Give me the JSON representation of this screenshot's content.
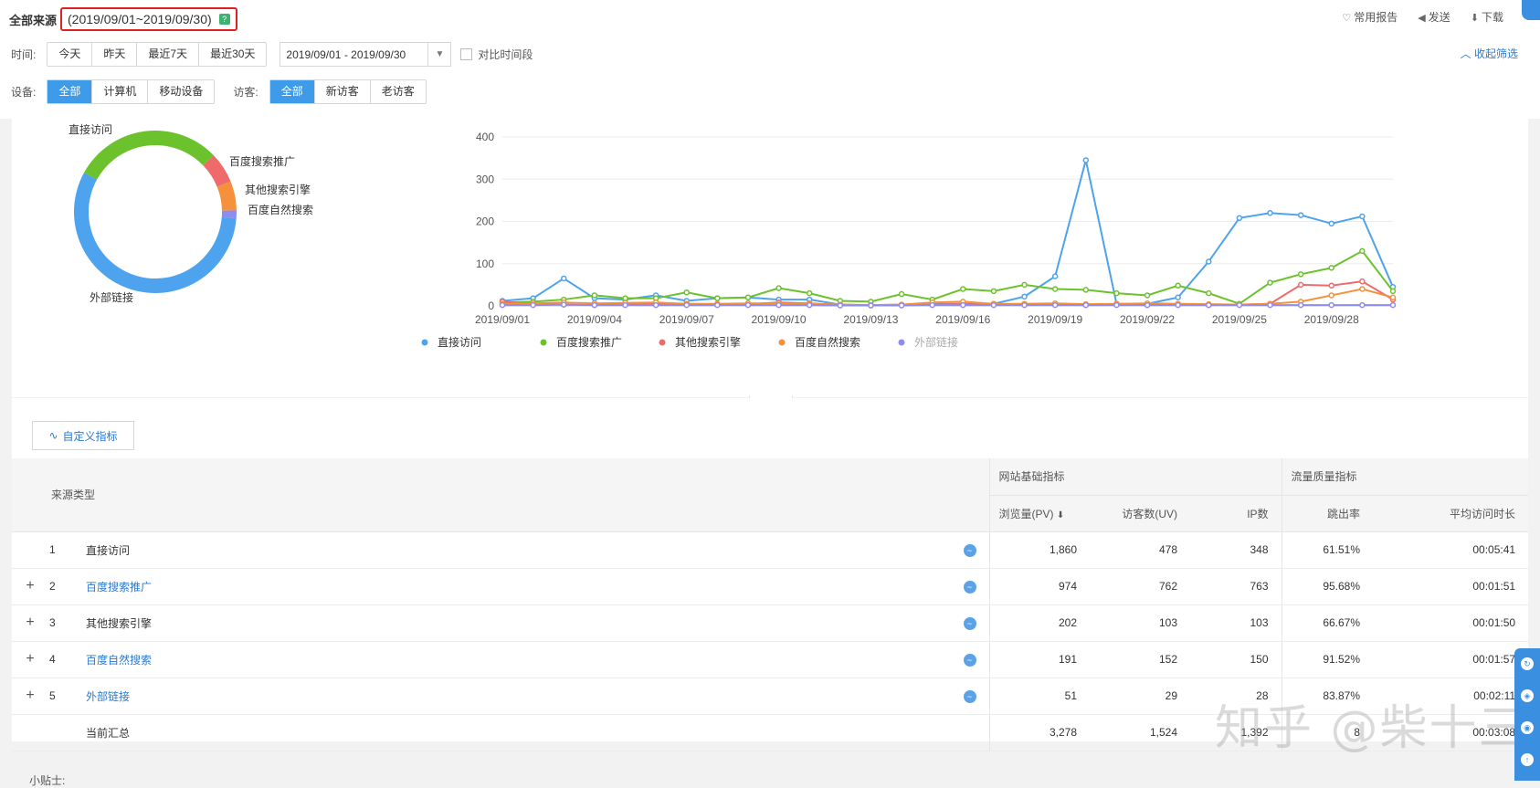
{
  "header": {
    "title": "全部来源",
    "date_range": "(2019/09/01~2019/09/30)",
    "help": "?",
    "actions": [
      {
        "icon": "heart-icon",
        "glyph": "♡",
        "label": "常用报告"
      },
      {
        "icon": "send-icon",
        "glyph": "◀",
        "label": "发送"
      },
      {
        "icon": "download-icon",
        "glyph": "⬇",
        "label": "下载"
      }
    ]
  },
  "filters": {
    "time_label": "时间:",
    "time_options": [
      "今天",
      "昨天",
      "最近7天",
      "最近30天"
    ],
    "date_value": "2019/09/01 - 2019/09/30",
    "compare_label": "对比时间段",
    "collapse_label": "收起筛选",
    "device_label": "设备:",
    "device_options": [
      "全部",
      "计算机",
      "移动设备"
    ],
    "visitor_label": "访客:",
    "visitor_options": [
      "全部",
      "新访客",
      "老访客"
    ]
  },
  "colors": {
    "direct": "#4da3ee",
    "baidu_promo": "#6cc22c",
    "other_search": "#ef6b6b",
    "baidu_natural": "#f5913c",
    "external": "#8c8cf2"
  },
  "chart_data": [
    {
      "type": "pie",
      "categories": [
        "直接访问",
        "百度搜索推广",
        "其他搜索引擎",
        "百度自然搜索",
        "外部链接"
      ],
      "values": [
        1860,
        974,
        202,
        191,
        51
      ]
    },
    {
      "type": "line",
      "x": [
        "2019/09/01",
        "2019/09/02",
        "2019/09/03",
        "2019/09/04",
        "2019/09/05",
        "2019/09/06",
        "2019/09/07",
        "2019/09/08",
        "2019/09/09",
        "2019/09/10",
        "2019/09/11",
        "2019/09/12",
        "2019/09/13",
        "2019/09/14",
        "2019/09/15",
        "2019/09/16",
        "2019/09/17",
        "2019/09/18",
        "2019/09/19",
        "2019/09/20",
        "2019/09/21",
        "2019/09/22",
        "2019/09/23",
        "2019/09/24",
        "2019/09/25",
        "2019/09/26",
        "2019/09/27",
        "2019/09/28",
        "2019/09/29",
        "2019/09/30"
      ],
      "x_tick_labels": [
        "2019/09/01",
        "2019/09/04",
        "2019/09/07",
        "2019/09/10",
        "2019/09/13",
        "2019/09/16",
        "2019/09/19",
        "2019/09/22",
        "2019/09/25",
        "2019/09/28"
      ],
      "ylim": [
        0,
        400
      ],
      "yticks": [
        "0",
        "100",
        "200",
        "300",
        "400"
      ],
      "legend_position": "bottom",
      "series": [
        {
          "name": "直接访问",
          "color": "#4da3ee",
          "values": [
            12,
            18,
            65,
            18,
            15,
            25,
            12,
            18,
            20,
            15,
            15,
            3,
            2,
            3,
            5,
            5,
            5,
            22,
            70,
            345,
            5,
            5,
            20,
            105,
            208,
            220,
            215,
            195,
            212,
            45
          ]
        },
        {
          "name": "百度搜索推广",
          "color": "#6cc22c",
          "values": [
            8,
            10,
            15,
            25,
            18,
            18,
            32,
            18,
            20,
            42,
            30,
            12,
            10,
            28,
            15,
            40,
            35,
            50,
            40,
            38,
            30,
            25,
            48,
            30,
            5,
            55,
            75,
            90,
            130,
            35
          ]
        },
        {
          "name": "其他搜索引擎",
          "color": "#ef6b6b",
          "values": [
            10,
            5,
            3,
            2,
            5,
            6,
            5,
            3,
            4,
            8,
            6,
            2,
            1,
            2,
            3,
            4,
            3,
            3,
            3,
            2,
            3,
            2,
            3,
            2,
            3,
            5,
            50,
            48,
            58,
            15
          ]
        },
        {
          "name": "百度自然搜索",
          "color": "#f5913c",
          "values": [
            5,
            6,
            8,
            6,
            7,
            8,
            5,
            5,
            6,
            6,
            5,
            3,
            2,
            3,
            8,
            10,
            5,
            5,
            6,
            4,
            5,
            6,
            5,
            4,
            3,
            5,
            10,
            25,
            40,
            20
          ]
        },
        {
          "name": "外部链接",
          "color": "#8c8cf2",
          "values": [
            2,
            2,
            3,
            2,
            2,
            2,
            2,
            2,
            2,
            2,
            2,
            1,
            1,
            1,
            2,
            2,
            2,
            2,
            2,
            2,
            2,
            2,
            2,
            2,
            2,
            2,
            2,
            2,
            2,
            2
          ]
        }
      ]
    }
  ],
  "custom_metrics_label": "自定义指标",
  "table": {
    "col_source": "来源类型",
    "group_basic": "网站基础指标",
    "group_quality": "流量质量指标",
    "col_pv": "浏览量(PV)",
    "sort_icon": "⬇",
    "col_uv": "访客数(UV)",
    "col_ip": "IP数",
    "col_bounce": "跳出率",
    "col_duration": "平均访问时长",
    "rows": [
      {
        "expand": "",
        "index": "1",
        "name": "直接访问",
        "link": false,
        "pv": "1,860",
        "uv": "478",
        "ip": "348",
        "bounce": "61.51%",
        "duration": "00:05:41"
      },
      {
        "expand": "+",
        "index": "2",
        "name": "百度搜索推广",
        "link": true,
        "pv": "974",
        "uv": "762",
        "ip": "763",
        "bounce": "95.68%",
        "duration": "00:01:51"
      },
      {
        "expand": "+",
        "index": "3",
        "name": "其他搜索引擎",
        "link": false,
        "pv": "202",
        "uv": "103",
        "ip": "103",
        "bounce": "66.67%",
        "duration": "00:01:50"
      },
      {
        "expand": "+",
        "index": "4",
        "name": "百度自然搜索",
        "link": true,
        "pv": "191",
        "uv": "152",
        "ip": "150",
        "bounce": "91.52%",
        "duration": "00:01:57"
      },
      {
        "expand": "+",
        "index": "5",
        "name": "外部链接",
        "link": true,
        "pv": "51",
        "uv": "29",
        "ip": "28",
        "bounce": "83.87%",
        "duration": "00:02:11"
      }
    ],
    "total": {
      "name": "当前汇总",
      "pv": "3,278",
      "uv": "1,524",
      "ip": "1,392",
      "bounce": "8",
      "duration": "00:03:08"
    }
  },
  "watermark": "知乎 @柴十三",
  "tip": "小贴士:"
}
